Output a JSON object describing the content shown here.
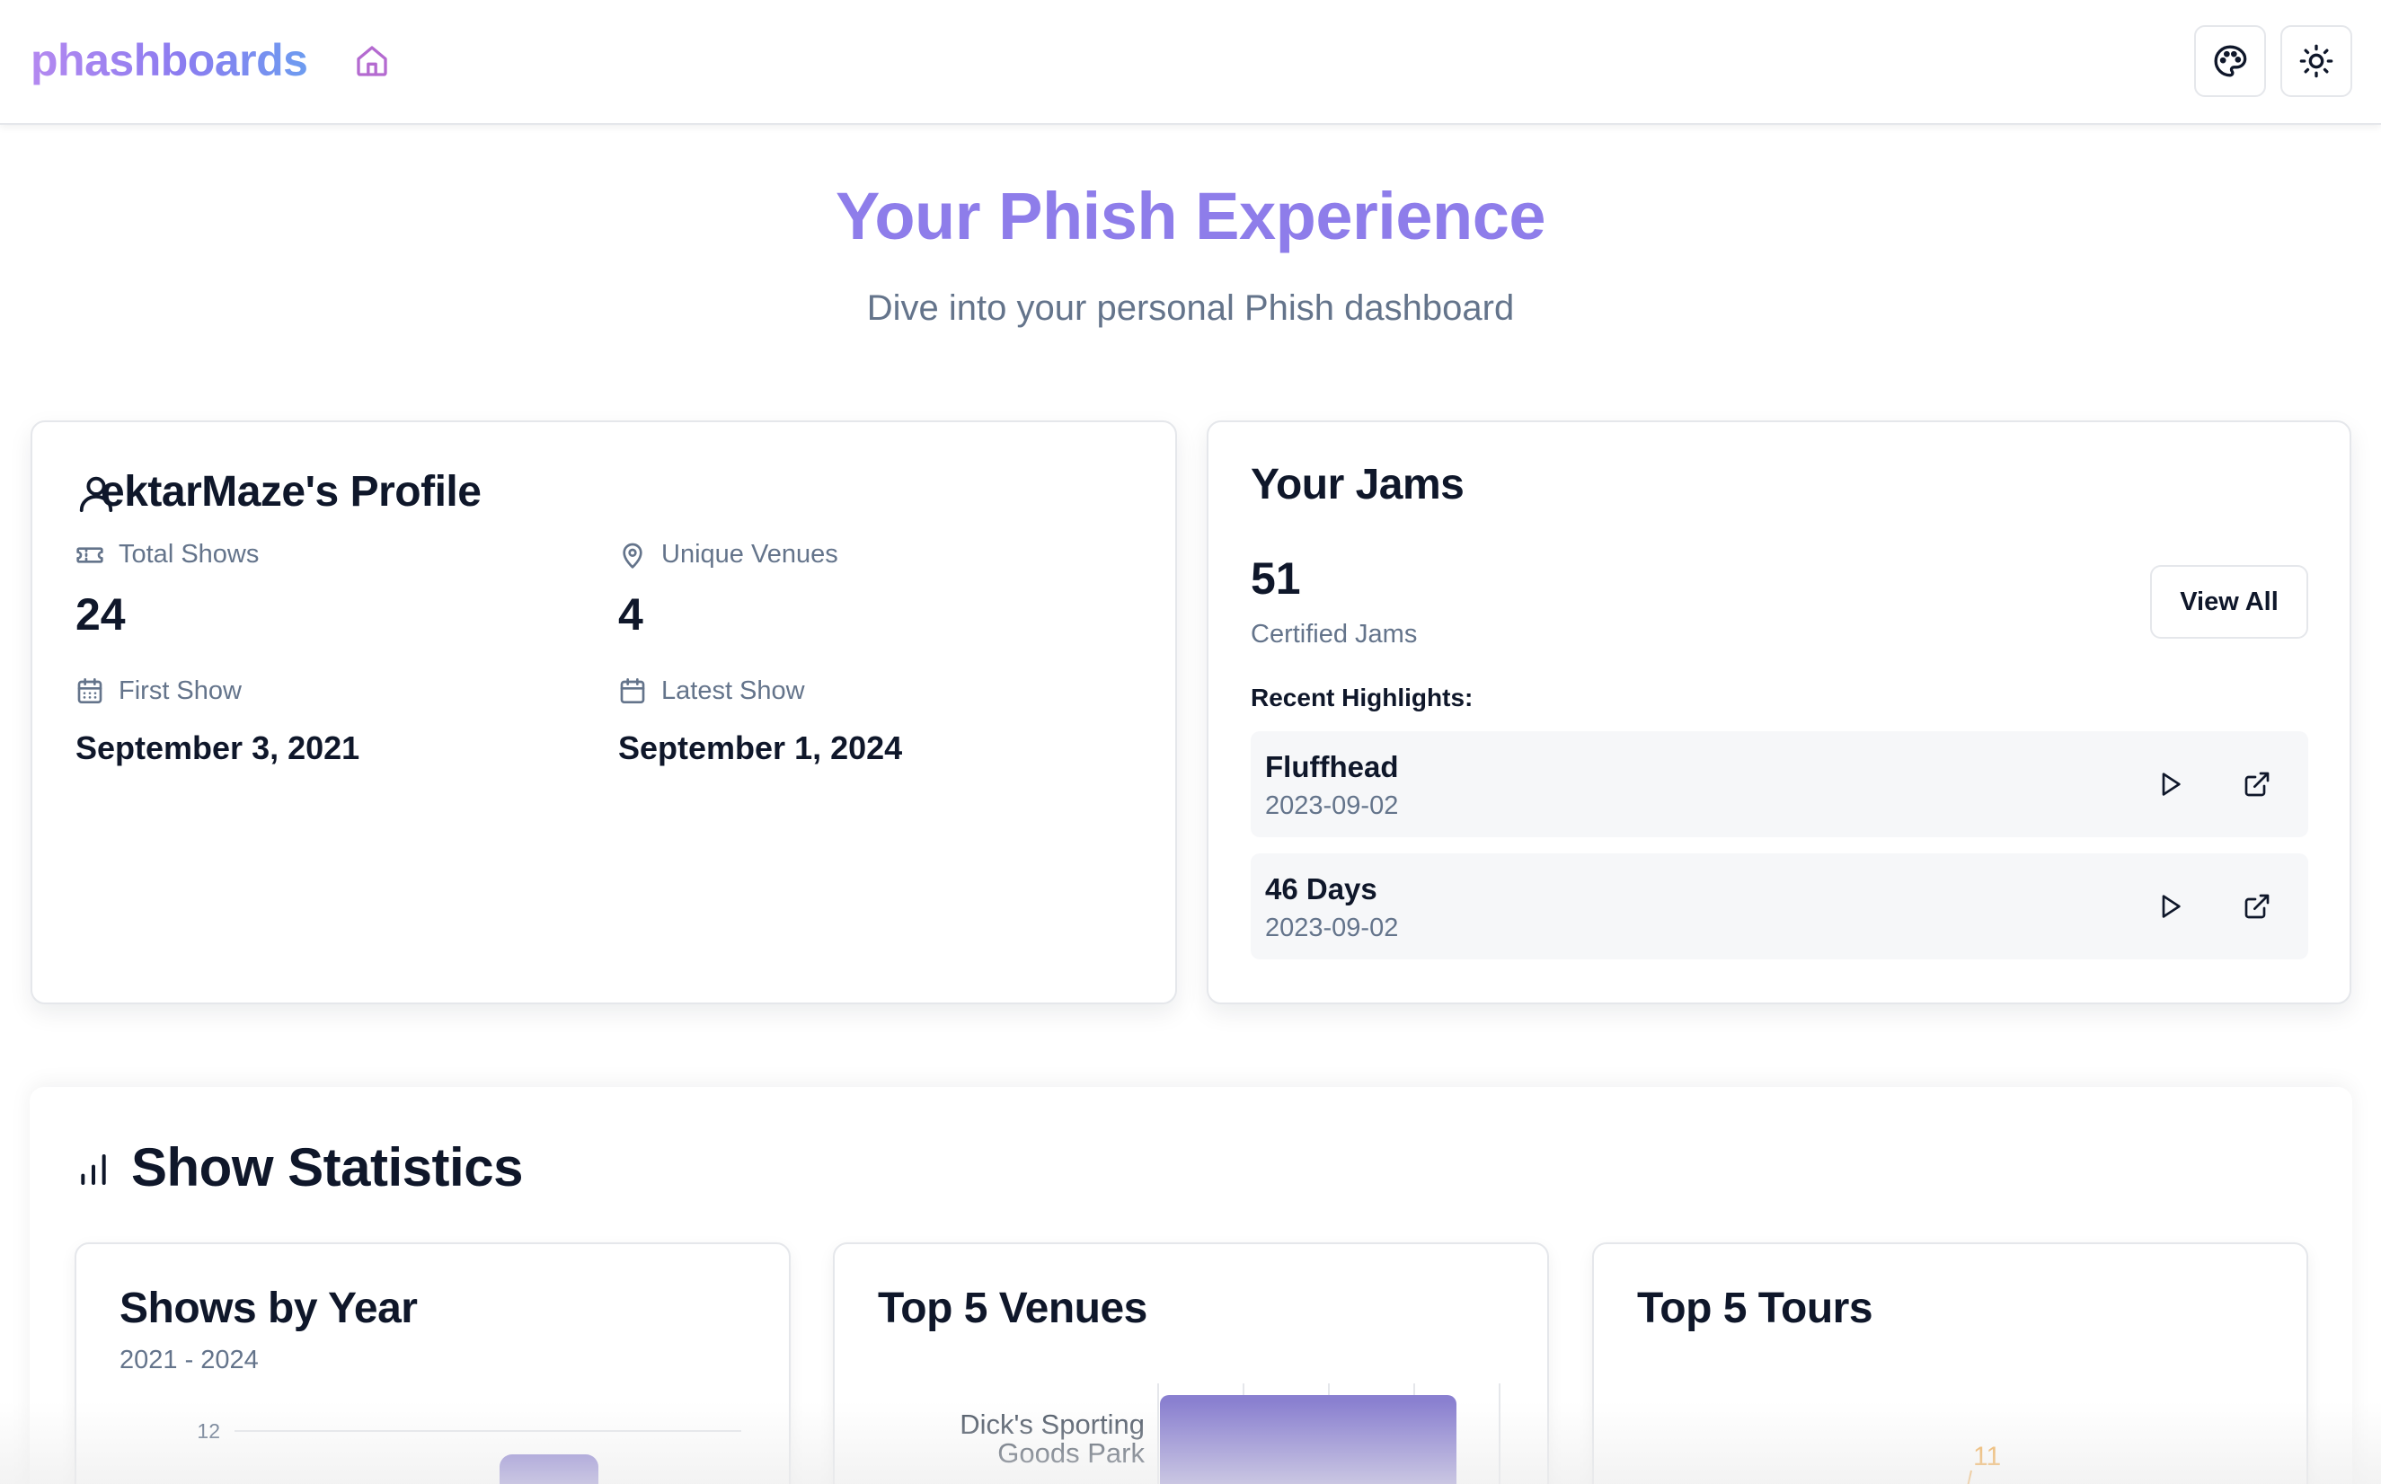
{
  "header": {
    "brand": "phashboards",
    "home_icon": "home-icon",
    "palette_icon": "palette-icon",
    "theme_icon": "sun-icon",
    "brand_gradient": [
      "#b489f0",
      "#6d9cf0"
    ],
    "accent": "#8e7dea"
  },
  "hero": {
    "title": "Your Phish Experience",
    "subtitle": "Dive into your personal Phish dashboard"
  },
  "profile": {
    "title": "ektarMaze's Profile",
    "icon": "user-icon",
    "stats": {
      "total_shows": {
        "label": "Total Shows",
        "value": "24",
        "icon": "ticket-icon"
      },
      "unique_venues": {
        "label": "Unique Venues",
        "value": "4",
        "icon": "map-pin-icon"
      },
      "first_show": {
        "label": "First Show",
        "value": "September 3, 2021",
        "icon": "calendar-icon"
      },
      "latest_show": {
        "label": "Latest Show",
        "value": "September 1, 2024",
        "icon": "calendar-icon"
      }
    }
  },
  "jams": {
    "title": "Your Jams",
    "count": "51",
    "count_label": "Certified Jams",
    "view_all_label": "View All",
    "highlights_label": "Recent Highlights:",
    "items": [
      {
        "name": "Fluffhead",
        "date": "2023-09-02"
      },
      {
        "name": "46 Days",
        "date": "2023-09-02"
      }
    ]
  },
  "stats": {
    "title": "Show Statistics",
    "icon": "bar-chart-icon",
    "cards": [
      {
        "title": "Shows by Year",
        "subtitle": "2021 - 2024"
      },
      {
        "title": "Top 5 Venues",
        "subtitle": ""
      },
      {
        "title": "Top 5 Tours",
        "subtitle": ""
      }
    ]
  },
  "chart_data": [
    {
      "type": "bar",
      "title": "Shows by Year",
      "subtitle": "2021 - 2024",
      "y_tick_labels": [
        "12"
      ],
      "ylim": [
        0,
        12
      ],
      "color": "#8a80d0"
    },
    {
      "type": "bar",
      "orientation": "horizontal",
      "title": "Top 5 Venues",
      "categories": [
        "Dick's Sporting Goods Park"
      ],
      "color": "#8a80d0"
    },
    {
      "type": "bar",
      "title": "Top 5 Tours",
      "data_labels": [
        "11"
      ],
      "color": "#f0a94a"
    }
  ]
}
